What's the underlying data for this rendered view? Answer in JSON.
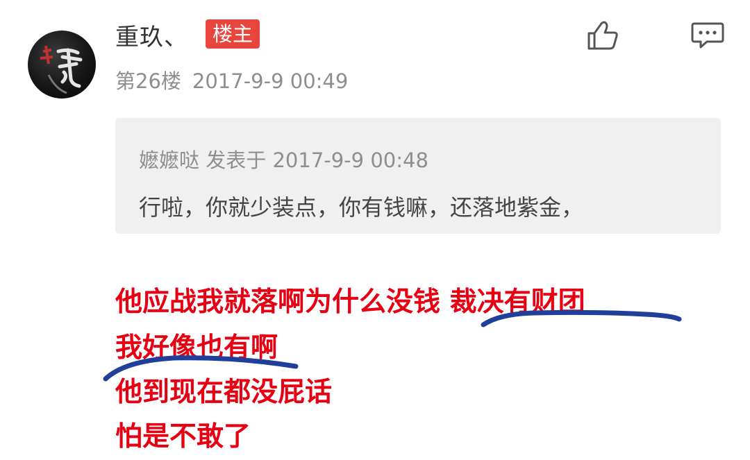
{
  "post": {
    "username": "重玖、",
    "owner_badge": "楼主",
    "floor": "第26楼",
    "timestamp": "2017-9-9 00:49"
  },
  "actions": {
    "like_icon": "thumbs-up-icon",
    "comment_icon": "comment-bubble-icon"
  },
  "quote": {
    "author": "嬷嬷哒",
    "posted_label": "发表于",
    "timestamp": "2017-9-9 00:48",
    "text": "行啦，你就少装点，你有钱嘛，还落地紫金，"
  },
  "annotation_lines": [
    "他应战我就落啊为什么没钱 裁决有财团",
    "我好像也有啊",
    "他到现在都没屁话",
    "怕是不敢了"
  ],
  "colors": {
    "annotation_text": "#e60012",
    "underline_stroke": "#1f3f9a",
    "owner_badge": "#e8453c",
    "quote_background": "#f0f0f0"
  }
}
